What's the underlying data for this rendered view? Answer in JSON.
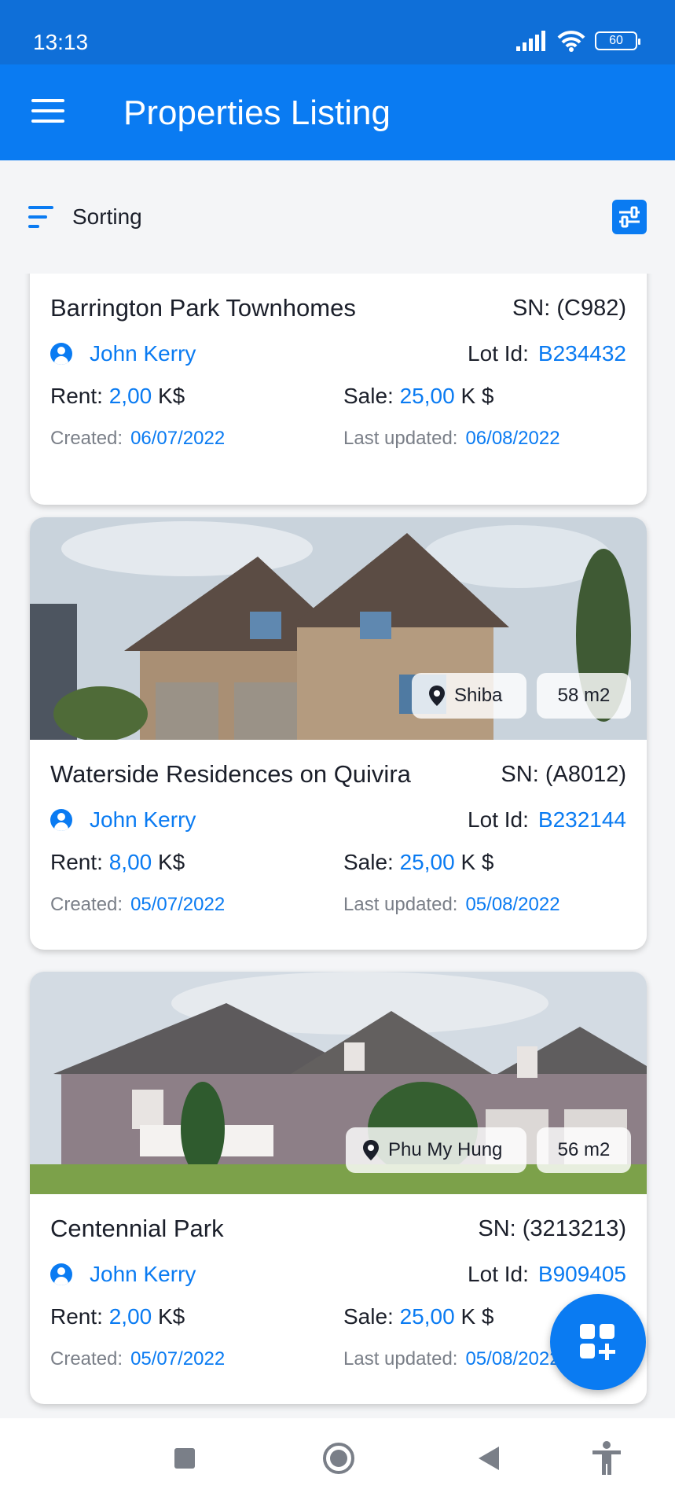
{
  "status_bar": {
    "time": "13:13",
    "battery": "60"
  },
  "app_bar": {
    "title": "Properties Listing",
    "menu_icon": "hamburger-menu-icon"
  },
  "toolbar": {
    "sort_label": "Sorting",
    "filter_icon": "filter-sliders-icon"
  },
  "labels": {
    "rent": "Rent:",
    "sale": "Sale:",
    "rent_unit": "K$",
    "sale_unit": "K $",
    "lot_id": "Lot Id:",
    "created": "Created:",
    "last_updated": "Last updated:"
  },
  "colors": {
    "primary": "#0a7bf2",
    "status_bar": "#0f6fd8",
    "background": "#f4f5f7"
  },
  "properties": [
    {
      "name": "Barrington Park Townhomes",
      "sn": "SN: (C982)",
      "agent": "John Kerry",
      "lot_id": "B234432",
      "rent": "2,00",
      "sale": "25,00",
      "created": "06/07/2022",
      "updated": "06/08/2022"
    },
    {
      "name": "Waterside Residences on Quivira",
      "sn": "SN: (A8012)",
      "agent": "John Kerry",
      "lot_id": "B232144",
      "rent": "8,00",
      "sale": "25,00",
      "created": "05/07/2022",
      "updated": "05/08/2022",
      "location": "Shiba",
      "area": "58 m2"
    },
    {
      "name": "Centennial Park",
      "sn": "SN: (3213213)",
      "agent": "John Kerry",
      "lot_id": "B909405",
      "rent": "2,00",
      "sale": "25,00",
      "created": "05/07/2022",
      "updated": "05/08/2022",
      "location": "Phu My Hung",
      "area": "56 m2"
    }
  ],
  "fab": {
    "icon": "add-apps-icon"
  },
  "nav_bar": {
    "icons": [
      "recents-square-icon",
      "home-circle-icon",
      "back-triangle-icon",
      "accessibility-icon"
    ]
  }
}
